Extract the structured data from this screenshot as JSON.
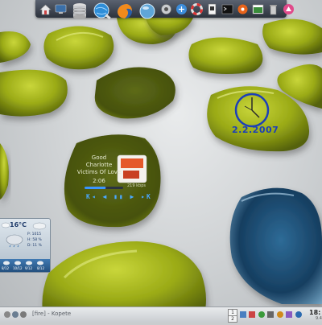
{
  "clock": {
    "date": "2.2.2007"
  },
  "media_player": {
    "line1": "Good",
    "line2": "Charlotte",
    "line3": "Victims Of Love",
    "elapsed": "2:06",
    "progress": 0.55,
    "size": "219 kbps",
    "controls": "K◂ ◀ ▮▮ ▶ ▸K",
    "cover_text": "Good Charlotte"
  },
  "weather": {
    "temperature": "16°C",
    "details": [
      "P: 1015",
      "H: 58 %",
      "D: 11 %"
    ],
    "days": [
      "8/12",
      "10/12",
      "9/12",
      "8/12"
    ]
  },
  "taskbar": {
    "pager": [
      "1",
      "2"
    ],
    "task_label": "[fire] - Kopete",
    "time": "18:",
    "sub": "9.4"
  },
  "colors": {
    "stone": "#a8b81c",
    "stone_dark": "#4f5a0e",
    "glass_blue": "#1f4f7a",
    "clock_blue": "#1c3fb8"
  }
}
